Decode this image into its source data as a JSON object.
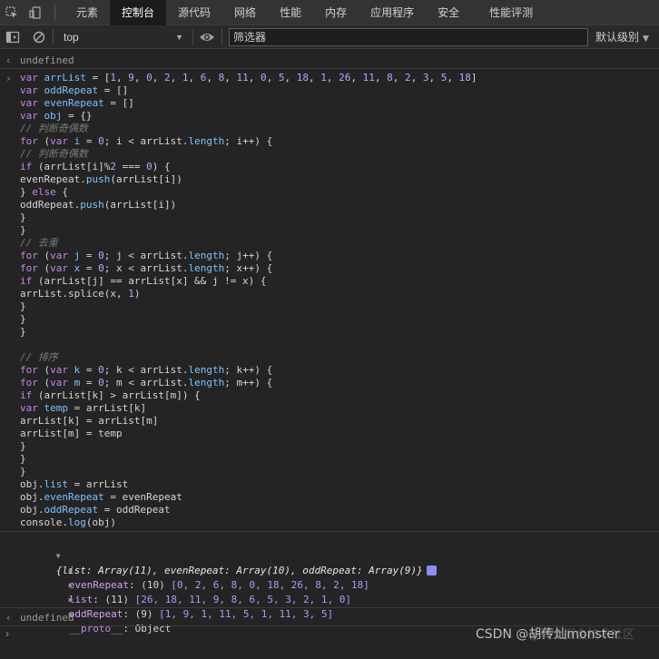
{
  "tabs": [
    {
      "label": "元素"
    },
    {
      "label": "控制台"
    },
    {
      "label": "源代码"
    },
    {
      "label": "网络"
    },
    {
      "label": "性能"
    },
    {
      "label": "内存"
    },
    {
      "label": "应用程序"
    },
    {
      "label": "安全"
    },
    {
      "label": "性能评测"
    }
  ],
  "toolbar": {
    "context": "top",
    "filter_value": "筛选器",
    "levels": "默认级别"
  },
  "console": {
    "first_output": "undefined",
    "code_lines": [
      "var arrList = [1, 9, 0, 2, 1, 6, 8, 11, 0, 5, 18, 1, 26, 11, 8, 2, 3, 5, 18]",
      "var oddRepeat = []",
      "var evenRepeat = []",
      "var obj = {}",
      "// 判断奇偶数",
      "for (var i = 0; i < arrList.length; i++) {",
      "// 判断奇偶数",
      "if (arrList[i]%2 === 0) {",
      "evenRepeat.push(arrList[i])",
      "} else {",
      "oddRepeat.push(arrList[i])",
      "}",
      "}",
      "// 去重",
      "for (var j = 0; j < arrList.length; j++) {",
      "for (var x = 0; x < arrList.length; x++) {",
      "if (arrList[j] == arrList[x] && j != x) {",
      "arrList.splice(x, 1)",
      "}",
      "}",
      "}",
      "",
      "// 排序",
      "for (var k = 0; k < arrList.length; k++) {",
      "for (var m = 0; m < arrList.length; m++) {",
      "if (arrList[k] > arrList[m]) {",
      "var temp = arrList[k]",
      "arrList[k] = arrList[m]",
      "arrList[m] = temp",
      "}",
      "}",
      "}",
      "obj.list = arrList",
      "obj.evenRepeat = evenRepeat",
      "obj.oddRepeat = oddRepeat",
      "console.log(obj)"
    ],
    "object_summary": "{list: Array(11), evenRepeat: Array(10), oddRepeat: Array(9)}",
    "properties": [
      {
        "key": "evenRepeat",
        "count": "(10)",
        "values": "[0, 2, 6, 8, 0, 18, 26, 8, 2, 18]"
      },
      {
        "key": "list",
        "count": "(11)",
        "values": "[26, 18, 11, 9, 8, 6, 5, 3, 2, 1, 0]"
      },
      {
        "key": "oddRepeat",
        "count": "(9)",
        "values": "[1, 9, 1, 11, 5, 1, 11, 3, 5]"
      }
    ],
    "proto_key": "__proto__",
    "proto_value": "Object",
    "second_output": "undefined"
  },
  "watermark": "CSDN @胡传灿monster",
  "watermark_faint": "@稀土掘金技术社区",
  "icons": [
    "inspect-icon",
    "device-toggle-icon",
    "sidebar-toggle-icon",
    "clear-console-icon",
    "eye-icon",
    "chevron-down-icon",
    "expand-triangle-icon",
    "info-badge-icon",
    "prompt-icon"
  ],
  "colors": {
    "background": "#242424",
    "tab_active": "#1b1b1b",
    "keyword": "#c586e9",
    "variable": "#7fc1ff",
    "number": "#bda6ff",
    "prompt": "#4aa3ff"
  }
}
